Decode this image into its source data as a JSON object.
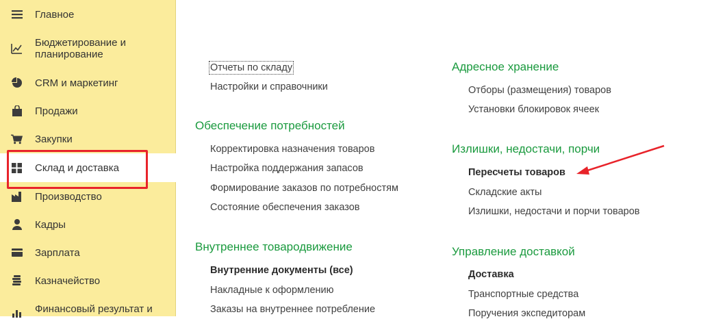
{
  "sidebar": {
    "items": [
      {
        "label": "Главное",
        "icon": "menu-lines-icon"
      },
      {
        "label": "Бюджетирование и\nпланирование",
        "icon": "budget-chart-icon"
      },
      {
        "label": "CRM и маркетинг",
        "icon": "pie-chart-icon"
      },
      {
        "label": "Продажи",
        "icon": "shopping-bag-icon"
      },
      {
        "label": "Закупки",
        "icon": "shopping-cart-icon"
      },
      {
        "label": "Склад и доставка",
        "icon": "warehouse-grid-icon",
        "active": true
      },
      {
        "label": "Производство",
        "icon": "factory-icon"
      },
      {
        "label": "Кадры",
        "icon": "person-icon"
      },
      {
        "label": "Зарплата",
        "icon": "wallet-icon"
      },
      {
        "label": "Казначейство",
        "icon": "coins-icon"
      },
      {
        "label": "Финансовый результат и",
        "icon": "bar-chart-icon"
      }
    ]
  },
  "columns": {
    "left": {
      "top_links": [
        {
          "label": "Отчеты по складу",
          "focused": true
        },
        {
          "label": "Настройки и справочники"
        }
      ],
      "groups": [
        {
          "title": "Обеспечение потребностей",
          "links": [
            {
              "label": "Корректировка назначения товаров"
            },
            {
              "label": "Настройка поддержания запасов"
            },
            {
              "label": "Формирование заказов по потребностям"
            },
            {
              "label": "Состояние обеспечения заказов"
            }
          ]
        },
        {
          "title": "Внутреннее товародвижение",
          "links": [
            {
              "label": "Внутренние документы (все)",
              "bold": true
            },
            {
              "label": "Накладные к оформлению"
            },
            {
              "label": "Заказы на внутреннее потребление"
            }
          ]
        }
      ]
    },
    "right": {
      "groups": [
        {
          "title": "Адресное хранение",
          "links": [
            {
              "label": "Отборы (размещения) товаров"
            },
            {
              "label": "Установки блокировок ячеек"
            }
          ]
        },
        {
          "title": "Излишки, недостачи, порчи",
          "links": [
            {
              "label": "Пересчеты товаров",
              "bold": true
            },
            {
              "label": "Складские акты"
            },
            {
              "label": "Излишки, недостачи и порчи товаров"
            }
          ]
        },
        {
          "title": "Управление доставкой",
          "links": [
            {
              "label": "Доставка",
              "bold": true
            },
            {
              "label": "Транспортные средства"
            },
            {
              "label": "Поручения экспедиторам"
            }
          ]
        }
      ]
    }
  },
  "colors": {
    "sidebar_bg": "#fbec9c",
    "group_title": "#1a9a3e",
    "annotation_red": "#e8232a",
    "icon_dark": "#3c3c3c"
  }
}
